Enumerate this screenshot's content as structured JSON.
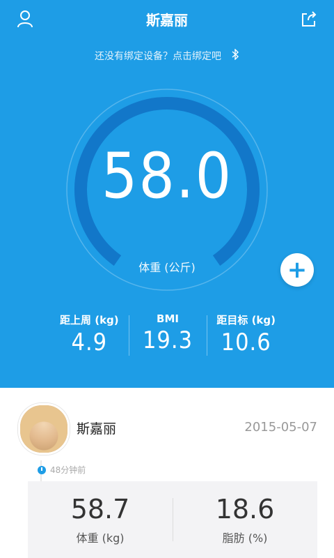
{
  "header": {
    "title": "斯嘉丽",
    "bind_hint": "还没有绑定设备？点击绑定吧",
    "user_icon": "user-icon",
    "share_icon": "share-icon",
    "bluetooth_icon": "bluetooth-icon"
  },
  "gauge": {
    "value": "58.0",
    "label": "体重 (公斤)"
  },
  "add_button": {
    "label": "+"
  },
  "stats": [
    {
      "label": "距上周 (kg)",
      "value": "4.9"
    },
    {
      "label": "BMI",
      "value": "19.3"
    },
    {
      "label": "距目标 (kg)",
      "value": "10.6"
    }
  ],
  "profile": {
    "name": "斯嘉丽",
    "date": "2015-05-07",
    "time_ago": "48分钟前"
  },
  "record": [
    {
      "value": "58.7",
      "label": "体重 (kg)"
    },
    {
      "value": "18.6",
      "label": "脂肪 (%)"
    }
  ],
  "colors": {
    "primary": "#1e9de6",
    "gauge_arc": "#1277c9"
  }
}
